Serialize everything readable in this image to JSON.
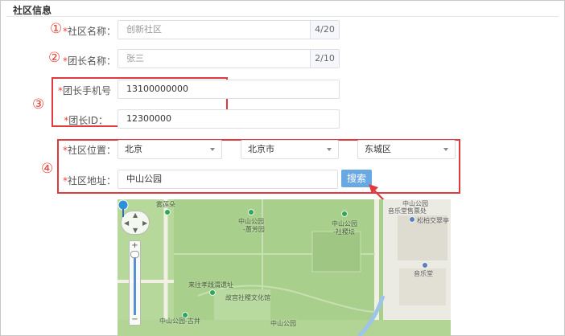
{
  "section": {
    "title": "社区信息"
  },
  "markers": [
    "①",
    "②",
    "③",
    "④"
  ],
  "form": {
    "community_name": {
      "label": "*社区名称：",
      "value": "创新社区",
      "count": "4/20"
    },
    "leader_name": {
      "label": "*团长名称：",
      "value": "张三",
      "count": "2/10"
    },
    "leader_phone": {
      "label": "*团长手机号",
      "value": "13100000000"
    },
    "leader_id": {
      "label": "*团长ID：",
      "value": "12300000"
    },
    "location": {
      "label": "*社区位置：",
      "province": "北京",
      "city": "北京市",
      "district": "东城区"
    },
    "address": {
      "label": "*社区地址：",
      "value": "中山公园",
      "search_label": "搜索"
    }
  },
  "map": {
    "labels": {
      "a": "雾莲朵",
      "b": "中山公园",
      "c": "-蕙芳园",
      "d": "中山公园",
      "e": "-社稷坛",
      "f": "中山公园",
      "g": "音乐堂售票处",
      "h": "松柏交翠亭",
      "i": "音乐堂",
      "j": "来往孝践渭遗址",
      "k": "故宫社稷文化馆",
      "l": "中山公园-古井",
      "m": "中山公园"
    },
    "zoom": {
      "plus": "+",
      "minus": "−"
    },
    "colors": {
      "park": "#a9cf8d",
      "road": "#f2f0e4",
      "water": "#9cc5e8",
      "pin": "#2f8fd8"
    }
  },
  "annotation": {
    "box_color": "#e0393e"
  }
}
